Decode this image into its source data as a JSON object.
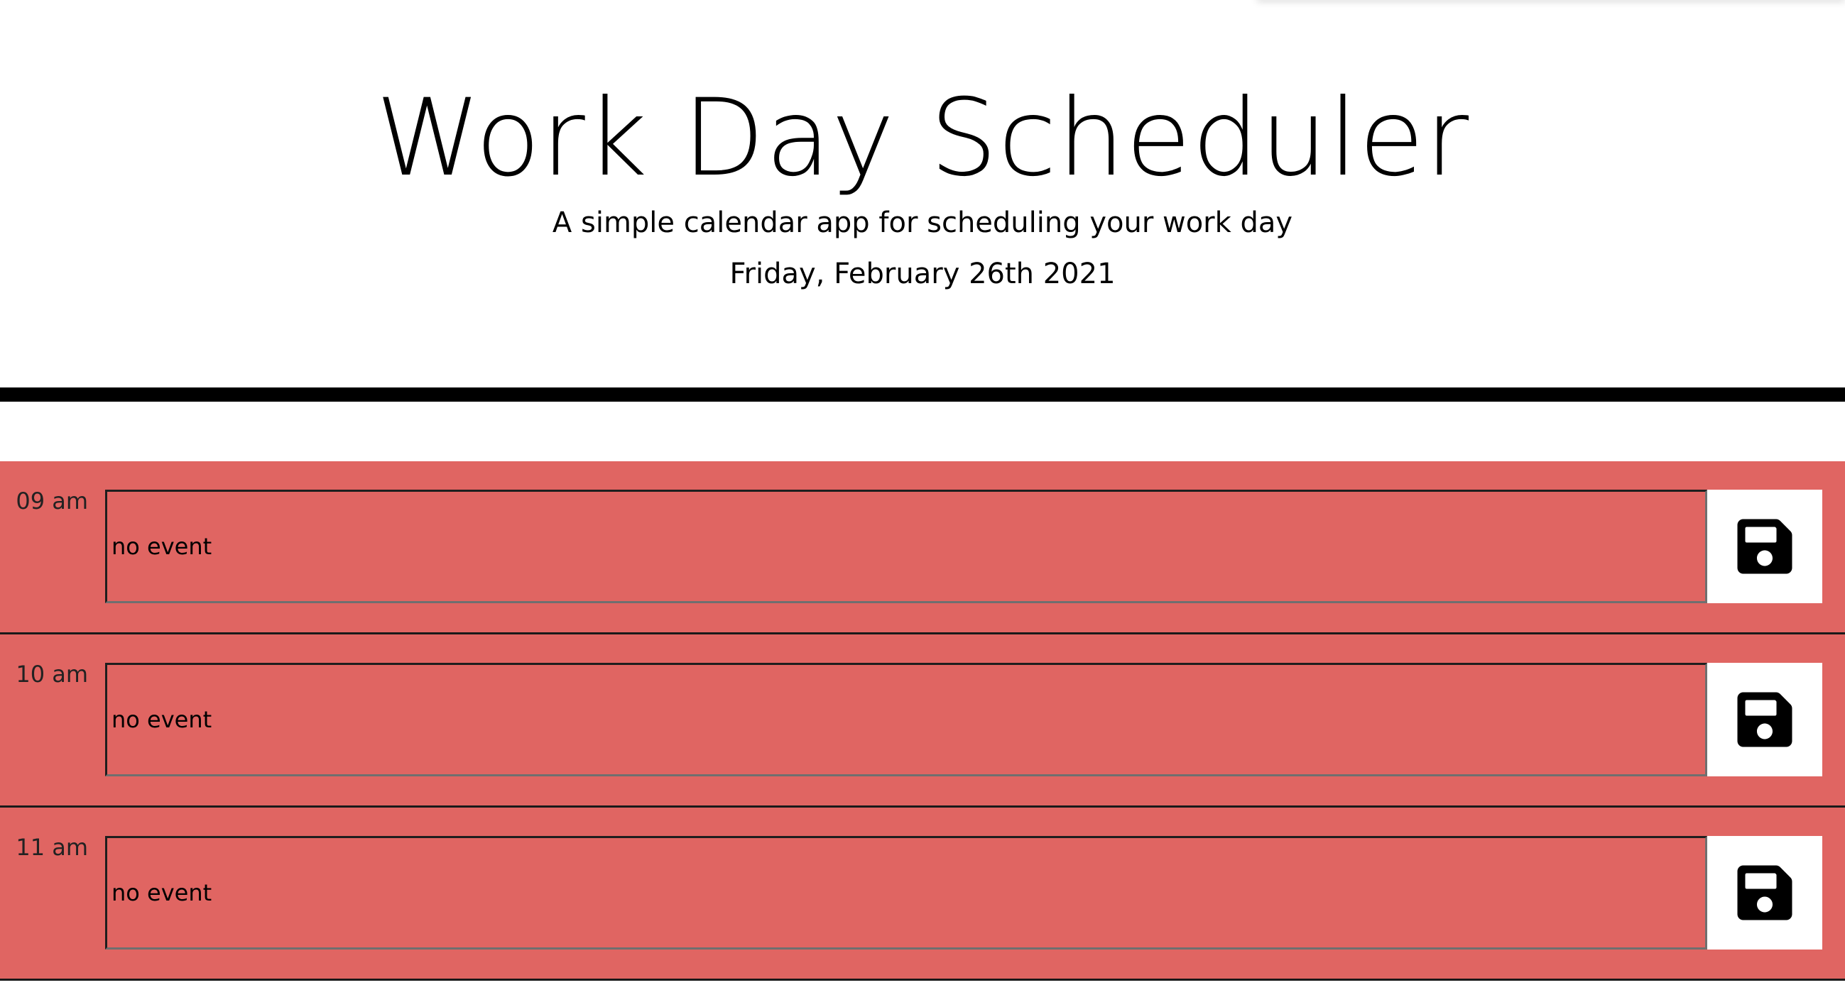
{
  "header": {
    "title": "Work Day Scheduler",
    "lead": "A simple calendar app for scheduling your work day",
    "current_day": "Friday, February 26th 2021"
  },
  "colors": {
    "past_row": "#e06562",
    "header_rule": "#000000",
    "save_button_bg": "#ffffff"
  },
  "timeblocks": [
    {
      "hour": "09 am",
      "event": "no event",
      "save_icon": "floppy-disk-icon"
    },
    {
      "hour": "10 am",
      "event": "no event",
      "save_icon": "floppy-disk-icon"
    },
    {
      "hour": "11 am",
      "event": "no event",
      "save_icon": "floppy-disk-icon"
    }
  ]
}
